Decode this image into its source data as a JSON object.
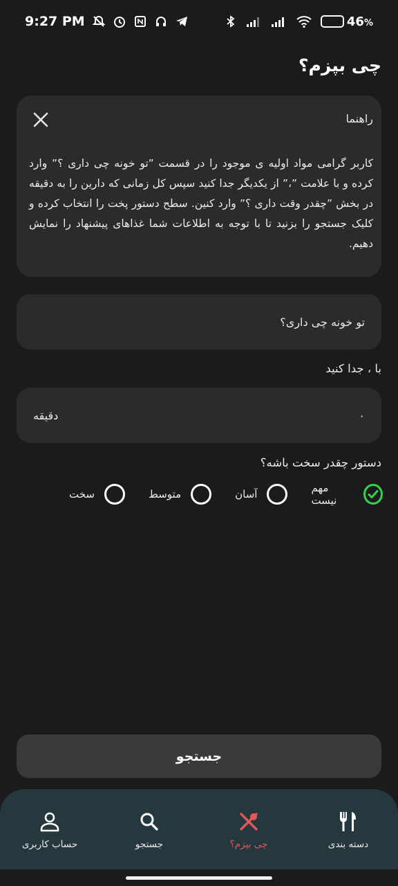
{
  "status_bar": {
    "time": "9:27 PM",
    "battery_percent": "46",
    "battery_suffix": "%",
    "battery_level": 0.46,
    "icons": [
      "mute-icon",
      "alarm-icon",
      "nfc-icon",
      "headset-icon",
      "telegram-icon",
      "bluetooth-icon",
      "signal-icon",
      "signal-icon",
      "wifi-icon",
      "battery-icon"
    ]
  },
  "header": {
    "title": "چی بپزم؟"
  },
  "guide": {
    "title": "راهنما",
    "close_icon": "close-icon",
    "text": "کاربر گرامی مواد اولیه ی موجود را در قسمت ”تو خونه چی داری ؟” وارد کرده و با علامت ”،” از یکدیگر جدا کنید سپس کل زمانی که دارین را به دقیقه در بخش ”چقدر وقت داری ؟” وارد کنین. سطح دستور پخت را انتخاب کرده و کلیک جستجو را بزنید تا با توجه به اطلاعات شما غذاهای پیشنهاد را نمایش دهیم."
  },
  "ingredients": {
    "placeholder": "تو خونه چی داری؟",
    "hint": "با ، جدا کنید"
  },
  "time": {
    "value": "۰",
    "unit": "دقیقه"
  },
  "difficulty": {
    "label": "دستور چقدر سخت باشه؟",
    "options": [
      {
        "label": "مهم نیست",
        "selected": true
      },
      {
        "label": "آسان",
        "selected": false
      },
      {
        "label": "متوسط",
        "selected": false
      },
      {
        "label": "سخت",
        "selected": false
      }
    ]
  },
  "search_button": {
    "label": "جستجو"
  },
  "bottom_nav": {
    "items": [
      {
        "label": "دسته بندی",
        "icon": "fork-knife-icon",
        "active": false
      },
      {
        "label": "چی بپزم؟",
        "icon": "crossed-utensils-icon",
        "active": true
      },
      {
        "label": "جستجو",
        "icon": "search-icon",
        "active": false
      },
      {
        "label": "حساب کاربری",
        "icon": "user-icon",
        "active": false
      }
    ]
  },
  "colors": {
    "background": "#1b1b1d",
    "card": "#2b2b2e",
    "accent_active": "#e0585a",
    "selected_radio": "#2fd64a",
    "nav_background": "#25383e"
  }
}
